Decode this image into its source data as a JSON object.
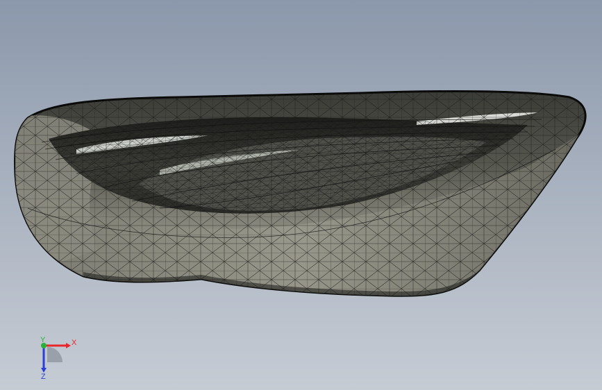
{
  "viewport": {
    "model": "mesh-shell-part",
    "render_mode": "shaded-with-edges",
    "background_top": "#8b98ab",
    "background_bottom": "#c6ccd4"
  },
  "triad": {
    "x_label": "X",
    "y_label": "Y",
    "z_label": "Z",
    "x_color": "#e8262b",
    "y_color": "#27b33a",
    "z_color": "#2b3fd8"
  }
}
